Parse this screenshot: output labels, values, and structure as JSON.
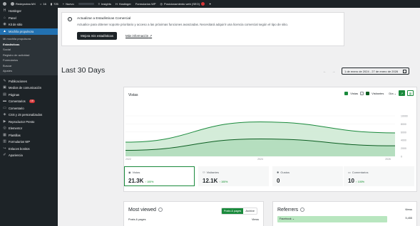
{
  "admin_bar": {
    "site_name": "Redeprotea MX",
    "comments": "16",
    "updates": "725",
    "new_label": "Nuevo",
    "insights": "Insights",
    "hostinger": "Hostinger",
    "forms": "Formularios WP",
    "seo": "Posicionamiento web (SEO)"
  },
  "sidebar": {
    "items_top": [
      {
        "icon": "hostinger-icon",
        "label": "Hostinger"
      },
      {
        "icon": "home-icon",
        "label": "Panel"
      },
      {
        "icon": "jetpack-icon",
        "label": "Kit de sitio"
      }
    ],
    "active": {
      "icon": "chart-icon",
      "label": "Mochila propulsora"
    },
    "submenu": [
      "Mi mochila propulsora",
      "Estadísticas",
      "Social",
      "Registro de actividad",
      "Formularios",
      "Buscar",
      "Ajustes"
    ],
    "submenu_current": "Estadísticas",
    "items_bottom": [
      {
        "icon": "pin-icon",
        "label": "Publicaciones",
        "badge": ""
      },
      {
        "icon": "media-icon",
        "label": "Medios de comunicación",
        "badge": ""
      },
      {
        "icon": "pages-icon",
        "label": "Páginas",
        "badge": ""
      },
      {
        "icon": "comments-icon",
        "label": "Comentarios",
        "badge": "16"
      },
      {
        "icon": "comment-box-icon",
        "label": "Comentario",
        "badge": ""
      },
      {
        "icon": "css-icon",
        "label": "CSS y JS personalizados",
        "badge": ""
      },
      {
        "icon": "player-icon",
        "label": "Reproductor Presto",
        "badge": ""
      },
      {
        "icon": "elementor-icon",
        "label": "Elementor",
        "badge": ""
      },
      {
        "icon": "templates-icon",
        "label": "Plantillas",
        "badge": ""
      },
      {
        "icon": "forms-icon",
        "label": "Formularios WP",
        "badge": ""
      },
      {
        "icon": "links-icon",
        "label": "Enlaces bonitos",
        "badge": ""
      },
      {
        "icon": "appearance-icon",
        "label": "Apariencia",
        "badge": ""
      }
    ]
  },
  "notice": {
    "title": "Actualizar a Estadísticas Comercial",
    "description": "Actualice para obtener soporte prioritario y acceso a las próximas funciones avanzadas. Necesitará adquirir una licencia comercial según el tipo de sitio.",
    "button": "Mejora mis estadísticas",
    "link": "Más información"
  },
  "header": {
    "title": "Last 30 Days",
    "arrows": "← →",
    "date_range": "1 de enero de 2024 - 27 de enero de 2026"
  },
  "chart": {
    "title": "Vistas",
    "legend_views": "Vistas",
    "legend_visitors": "Visitantes",
    "period": "Día",
    "x_ticks": [
      "2022",
      "2024",
      "2026"
    ],
    "y_ticks": [
      "10000",
      "8000",
      "6000",
      "4000",
      "2000",
      "0"
    ]
  },
  "chart_data": {
    "type": "area",
    "x": [
      "2022",
      "2024",
      "2026"
    ],
    "yticks": [
      0,
      2000,
      4000,
      6000,
      8000,
      10000
    ],
    "ylim": [
      0,
      10000
    ],
    "series": [
      {
        "name": "Vistas",
        "values": [
          3500,
          8500,
          5800
        ]
      },
      {
        "name": "Visitantes",
        "values": [
          1500,
          4300,
          2600
        ]
      }
    ],
    "colors": {
      "Vistas": "#1a8a3c",
      "Visitantes": "#0b5d20",
      "fill": "#cfead5"
    }
  },
  "stats": [
    {
      "label": "Vistas",
      "icon": "eye-icon",
      "value": "21.3K",
      "delta": "↑ 100%"
    },
    {
      "label": "Visitantes",
      "icon": "visitors-icon",
      "value": "12.1K",
      "delta": "↑ 100%"
    },
    {
      "label": "Gustos",
      "icon": "star-icon",
      "value": "0",
      "delta": ""
    },
    {
      "label": "Comentarios",
      "icon": "comment-icon",
      "value": "10",
      "delta": "↑ 100%"
    }
  ],
  "most_viewed": {
    "title": "Most viewed",
    "toggle_on": "Posts & pages",
    "toggle_off": "Archive",
    "col_left": "Posts & pages",
    "col_right": "Views"
  },
  "referrers": {
    "title": "Referrers",
    "col_right": "Views",
    "row_label": "Facebook",
    "row_value": "5,455"
  },
  "colors": {
    "accent": "#1a8a3c",
    "admin_dark": "#1d2327",
    "active_menu": "#2271b1"
  }
}
